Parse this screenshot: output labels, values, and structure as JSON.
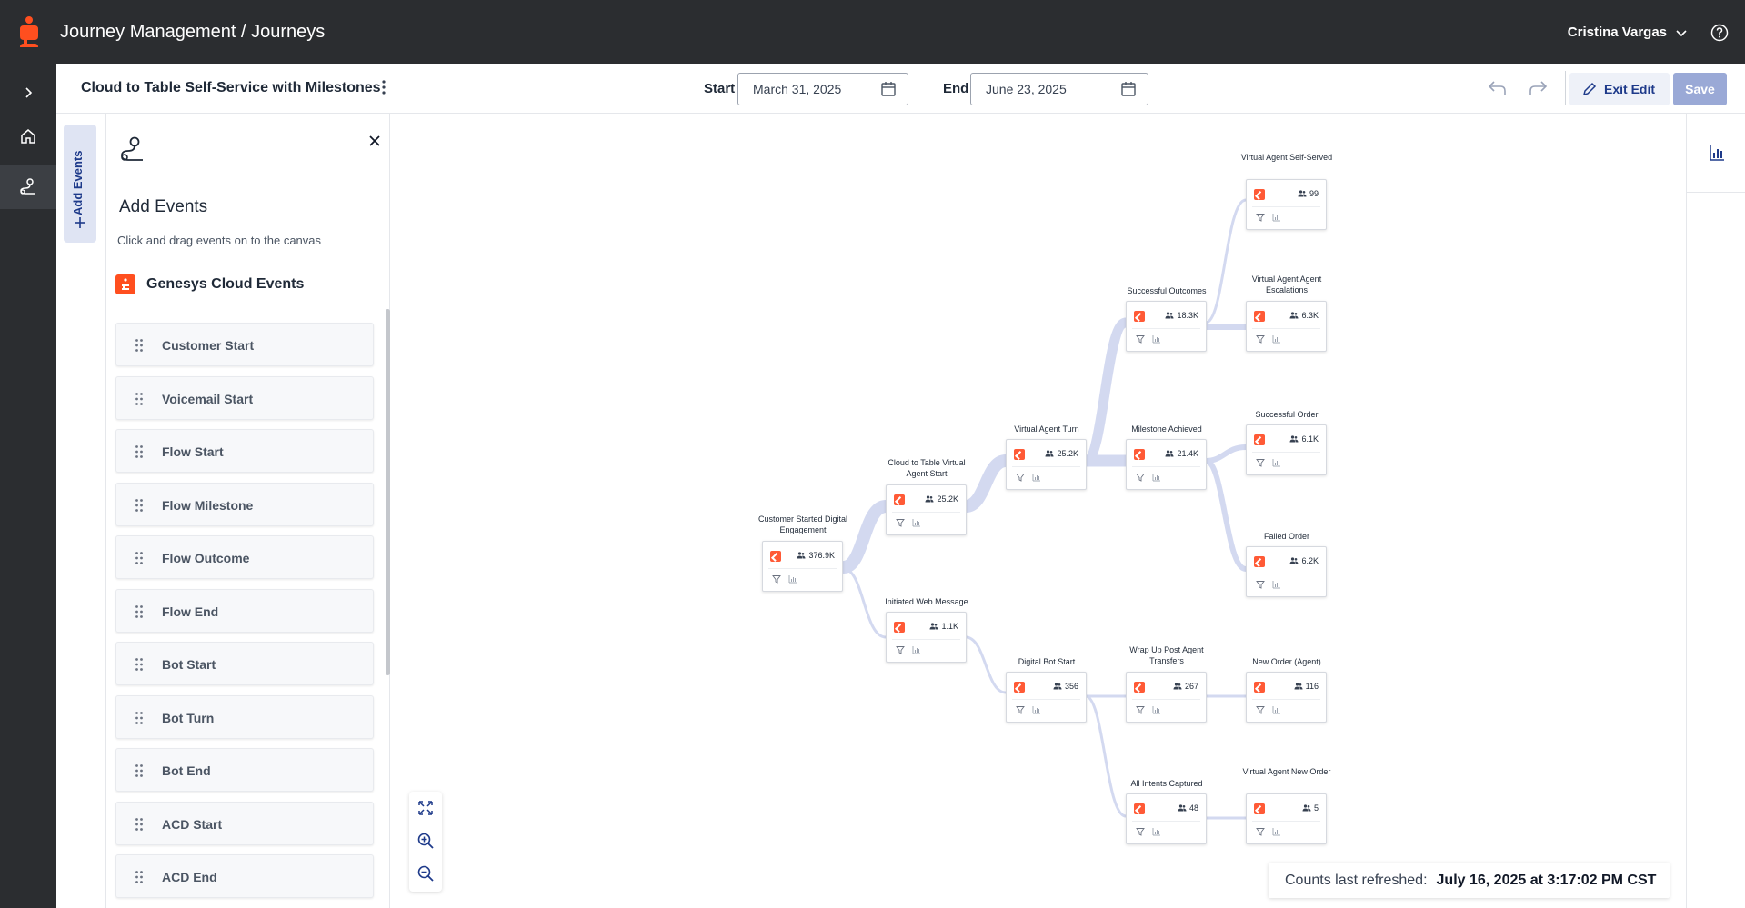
{
  "app": {
    "breadcrumb": "Journey Management / Journeys",
    "user_name": "Cristina Vargas",
    "brand_color": "#ff4f1f"
  },
  "nav": {
    "items": [
      {
        "name": "expand",
        "icon": "chevron-right-icon"
      },
      {
        "name": "home",
        "icon": "home-icon"
      },
      {
        "name": "journeys",
        "icon": "journey-icon",
        "active": true
      }
    ]
  },
  "header": {
    "journey_title": "Cloud to Table Self-Service with Milestones",
    "start_label": "Start",
    "start_value": "March 31, 2025",
    "end_label": "End",
    "end_value": "June 23, 2025",
    "exit_edit_label": "Exit Edit",
    "save_label": "Save"
  },
  "add_tab": {
    "label": "Add Events"
  },
  "panel": {
    "title": "Add Events",
    "subtitle": "Click and drag events on to the canvas",
    "section_title": "Genesys Cloud Events",
    "events": [
      "Customer Start",
      "Voicemail Start",
      "Flow Start",
      "Flow Milestone",
      "Flow Outcome",
      "Flow End",
      "Bot Start",
      "Bot Turn",
      "Bot End",
      "ACD Start",
      "ACD End"
    ]
  },
  "nodes": [
    {
      "id": "n1",
      "label": "Customer Started Digital Engagement",
      "count": "376.9K"
    },
    {
      "id": "n2",
      "label": "Cloud to Table Virtual Agent Start",
      "count": "25.2K"
    },
    {
      "id": "n3",
      "label": "Initiated Web Message",
      "count": "1.1K"
    },
    {
      "id": "n4",
      "label": "Virtual Agent Turn",
      "count": "25.2K"
    },
    {
      "id": "n5",
      "label": "Digital Bot Start",
      "count": "356"
    },
    {
      "id": "n6",
      "label": "Successful Outcomes",
      "count": "18.3K"
    },
    {
      "id": "n7",
      "label": "Milestone Achieved",
      "count": "21.4K"
    },
    {
      "id": "n8",
      "label": "Wrap Up Post Agent Transfers",
      "count": "267"
    },
    {
      "id": "n9",
      "label": "All Intents Captured",
      "count": "48"
    },
    {
      "id": "n10",
      "label": "Virtual Agent Self-Served",
      "count": "99"
    },
    {
      "id": "n11",
      "label": "Virtual Agent Agent Escalations",
      "count": "6.3K"
    },
    {
      "id": "n12",
      "label": "Successful Order",
      "count": "6.1K"
    },
    {
      "id": "n13",
      "label": "Failed Order",
      "count": "6.2K"
    },
    {
      "id": "n14",
      "label": "New Order (Agent)",
      "count": "116"
    },
    {
      "id": "n15",
      "label": "Virtual Agent New Order",
      "count": "5"
    }
  ],
  "refresh": {
    "label": "Counts last refreshed:",
    "value": "July 16, 2025 at 3:17:02 PM CST"
  }
}
